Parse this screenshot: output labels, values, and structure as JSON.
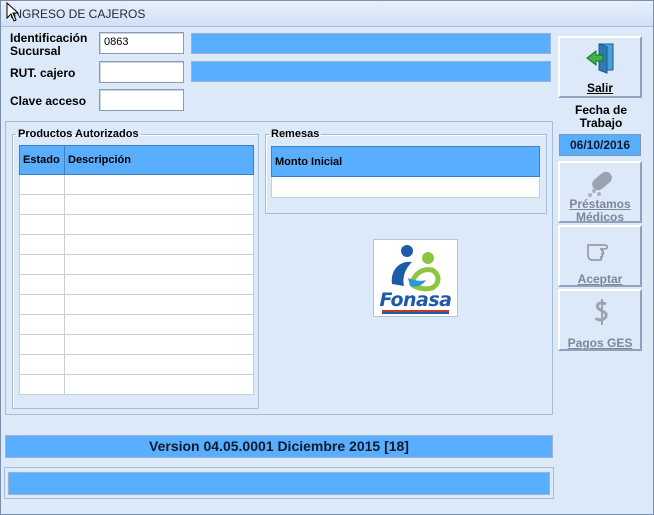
{
  "window": {
    "title": "INGRESO DE CAJEROS"
  },
  "form": {
    "sucursal_label": "Identificación Sucursal",
    "sucursal_value": "0863",
    "rut_label": "RUT. cajero",
    "rut_value": "",
    "clave_label": "Clave acceso",
    "clave_value": ""
  },
  "productos": {
    "legend": "Productos Autorizados",
    "columns": [
      "Estado",
      "Descripción"
    ],
    "rows": 11
  },
  "remesas": {
    "legend": "Remesas",
    "columns": [
      "Monto Inicial"
    ]
  },
  "logo": {
    "text": "Fonasa"
  },
  "sidebar": {
    "salir_label": "Salir",
    "fecha_label": "Fecha de Trabajo",
    "fecha_value": "06/10/2016",
    "prestamos_label_1": "Préstamos",
    "prestamos_label_2": "Médicos",
    "aceptar_label": "Aceptar",
    "pagos_label": "Pagos GES"
  },
  "footer": {
    "version": "Version 04.05.0001 Diciembre 2015 [18]",
    "status": ""
  },
  "colors": {
    "accent": "#5aaeff",
    "background": "#dbe9f9",
    "fonasa_blue": "#1e5aa8",
    "fonasa_green": "#8cc63f"
  }
}
